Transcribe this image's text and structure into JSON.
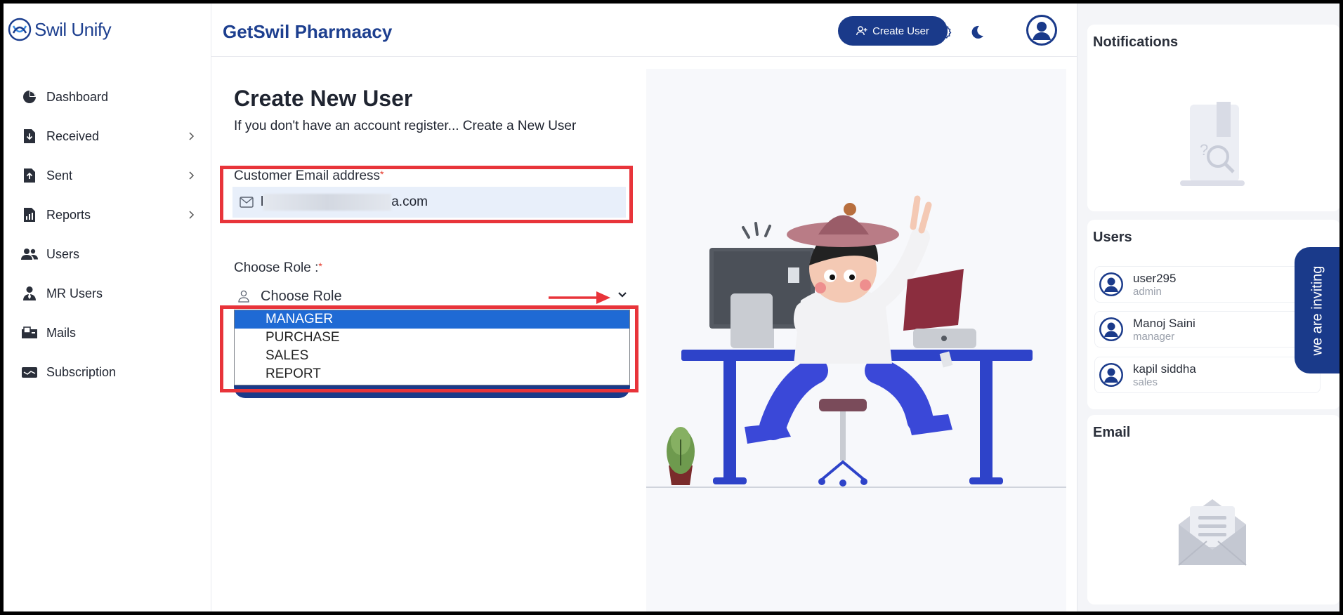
{
  "brand": {
    "name": "Swil Unify"
  },
  "sidebar": {
    "items": [
      {
        "label": "Dashboard",
        "icon": "pie-chart-icon",
        "chevron": false
      },
      {
        "label": "Received",
        "icon": "download-doc-icon",
        "chevron": true
      },
      {
        "label": "Sent",
        "icon": "upload-doc-icon",
        "chevron": true
      },
      {
        "label": "Reports",
        "icon": "report-doc-icon",
        "chevron": true
      },
      {
        "label": "Users",
        "icon": "users-icon",
        "chevron": false
      },
      {
        "label": "MR Users",
        "icon": "user-tie-icon",
        "chevron": false
      },
      {
        "label": "Mails",
        "icon": "mail-box-icon",
        "chevron": false
      },
      {
        "label": "Subscription",
        "icon": "wallet-icon",
        "chevron": false
      }
    ]
  },
  "header": {
    "title": "GetSwil Pharmaacy",
    "create_user_label": "Create User"
  },
  "form": {
    "title": "Create New User",
    "subtitle": "If you don't have an account register... Create a New User",
    "email_label": "Customer Email address",
    "email_value_visible": "a.com",
    "email_value_prefix": "l",
    "required_mark": "*",
    "role_label": "Choose Role :",
    "role_placeholder": "Choose Role",
    "role_options": [
      "MANAGER",
      "PURCHASE",
      "SALES",
      "REPORT"
    ],
    "role_selected": "MANAGER"
  },
  "right_panel": {
    "notifications_title": "Notifications",
    "users_title": "Users",
    "users": [
      {
        "name": "user295",
        "role": "admin"
      },
      {
        "name": "Manoj Saini",
        "role": "manager"
      },
      {
        "name": "kapil siddha",
        "role": "sales"
      }
    ],
    "email_title": "Email"
  },
  "invite_tab": {
    "label": "we are inviting"
  },
  "colors": {
    "brand_navy": "#1a3a8a",
    "highlight_red": "#e8343a",
    "selected_option": "#1f6ad4"
  }
}
